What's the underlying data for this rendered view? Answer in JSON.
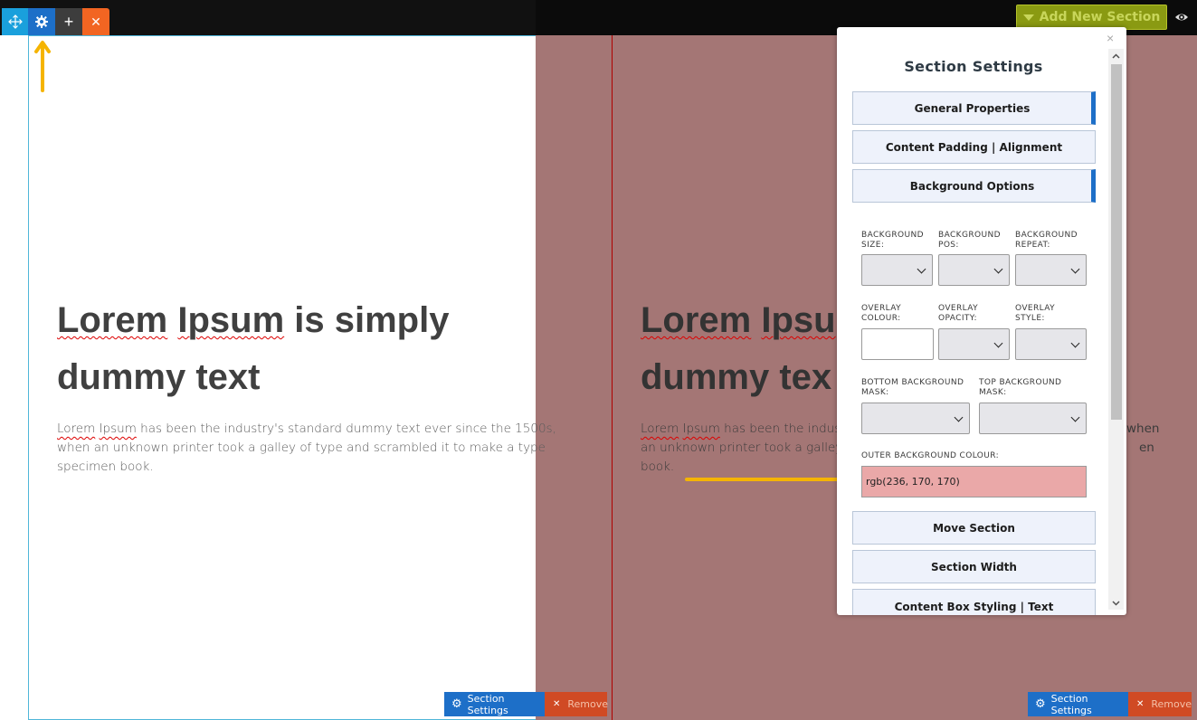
{
  "toolbar": {
    "move_icon": "move-arrows-icon",
    "settings_icon": "gear-icon",
    "add_label": "+",
    "close_label": "✕"
  },
  "header": {
    "add_new_section_label": "Add New Section",
    "eye_icon": "eye-icon"
  },
  "content": {
    "heading_line1_a": "Lorem",
    "heading_line1_b": "Ipsum",
    "heading_line1_c": " is simply",
    "heading_line2": "dummy text",
    "paragraph_a": "Lorem",
    "paragraph_b": "Ipsum",
    "paragraph_rest": " has been the industry's standard dummy text ever since the 1500s, when an unknown printer took a galley of type and scrambled it to make a type specimen book.",
    "right_heading_line1_a": "Lorem",
    "right_heading_line1_b": "Ipsu",
    "right_heading_line2": "dummy tex",
    "right_paragraph_line1_a": "Lorem",
    "right_paragraph_line1_b": "Ipsum",
    "right_paragraph_line1_rest": " has been the indus",
    "right_paragraph_line2": "an unknown printer took a galley",
    "right_paragraph_line3": "book.",
    "right_tail_line1": "when",
    "right_tail_line2": "en"
  },
  "bottom_buttons": {
    "section_settings_label": "Section Settings",
    "remove_label": "Remove"
  },
  "panel": {
    "title": "Section Settings",
    "close_label": "×",
    "accordion": [
      {
        "label": "General Properties"
      },
      {
        "label": "Content Padding | Alignment"
      },
      {
        "label": "Background Options"
      },
      {
        "label": "Move Section"
      },
      {
        "label": "Section Width"
      },
      {
        "label": "Content Box Styling | Text"
      }
    ],
    "fields": {
      "bg_size": "BACKGROUND SIZE:",
      "bg_pos": "BACKGROUND POS:",
      "bg_repeat": "BACKGROUND REPEAT:",
      "overlay_colour": "OVERLAY COLOUR:",
      "overlay_opacity": "OVERLAY OPACITY:",
      "overlay_style": "OVERLAY STYLE:",
      "bottom_mask": "BOTTOM BACKGROUND MASK:",
      "top_mask": "TOP BACKGROUND MASK:",
      "outer_bg_colour": "OUTER BACKGROUND COLOUR:",
      "outer_bg_colour_value": "rgb(236, 170, 170)"
    }
  },
  "colors": {
    "accent_blue": "#1d6fc8",
    "remove_orange": "#d04a24",
    "add_section_green": "#8a9a12",
    "section_bg": "#a47675",
    "annotation_arrow": "#f5b400"
  }
}
